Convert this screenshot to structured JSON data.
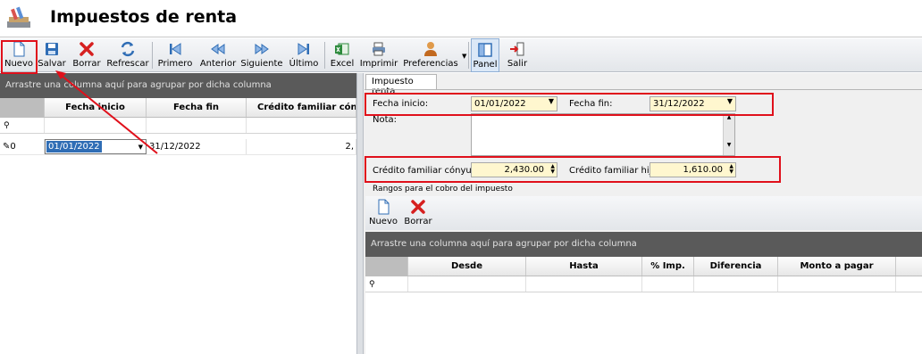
{
  "window": {
    "title": "Impuestos de renta"
  },
  "toolbar": {
    "items": [
      {
        "label": "Nuevo",
        "icon": "new-document-icon"
      },
      {
        "label": "Salvar",
        "icon": "save-icon"
      },
      {
        "label": "Borrar",
        "icon": "delete-icon"
      },
      {
        "label": "Refrescar",
        "icon": "refresh-icon"
      },
      {
        "label": "Primero",
        "icon": "first-record-icon"
      },
      {
        "label": "Anterior",
        "icon": "previous-record-icon"
      },
      {
        "label": "Siguiente",
        "icon": "next-record-icon"
      },
      {
        "label": "Último",
        "icon": "last-record-icon"
      },
      {
        "label": "Excel",
        "icon": "excel-icon"
      },
      {
        "label": "Imprimir",
        "icon": "print-icon"
      },
      {
        "label": "Preferencias",
        "icon": "preferences-icon"
      },
      {
        "label": "Panel",
        "icon": "panel-icon"
      },
      {
        "label": "Salir",
        "icon": "exit-icon"
      }
    ]
  },
  "left_grid": {
    "group_hint": "Arrastre una columna aquí para agrupar por dicha columna",
    "columns": [
      "Fecha inicio",
      "Fecha fin",
      "Crédito familiar cónyu"
    ],
    "rows": [
      {
        "indicator": "0",
        "fecha_inicio": "01/01/2022",
        "fecha_fin": "31/12/2022",
        "credito": "2,"
      }
    ]
  },
  "detail": {
    "tab_label": "Impuesto renta",
    "fecha_inicio_label": "Fecha inicio:",
    "fecha_inicio_value": "01/01/2022",
    "fecha_fin_label": "Fecha fin:",
    "fecha_fin_value": "31/12/2022",
    "nota_label": "Nota:",
    "credito_conyuge_label": "Crédito familiar cónyuge:",
    "credito_conyuge_value": "2,430.00",
    "credito_hijo_label": "Crédito familiar hijo:",
    "credito_hijo_value": "1,610.00",
    "rangos_label": "Rangos para el cobro del impuesto"
  },
  "sub_toolbar": {
    "nuevo_label": "Nuevo",
    "borrar_label": "Borrar"
  },
  "ranges_grid": {
    "group_hint": "Arrastre una columna aquí para agrupar por dicha columna",
    "columns": [
      "Desde",
      "Hasta",
      "% Imp.",
      "Diferencia",
      "Monto a pagar"
    ]
  },
  "colors": {
    "highlight_box": "#e0101b",
    "annotation_arrow": "#e0101b",
    "field_background": "#fff7cf",
    "group_bar": "#5a5a5a"
  }
}
